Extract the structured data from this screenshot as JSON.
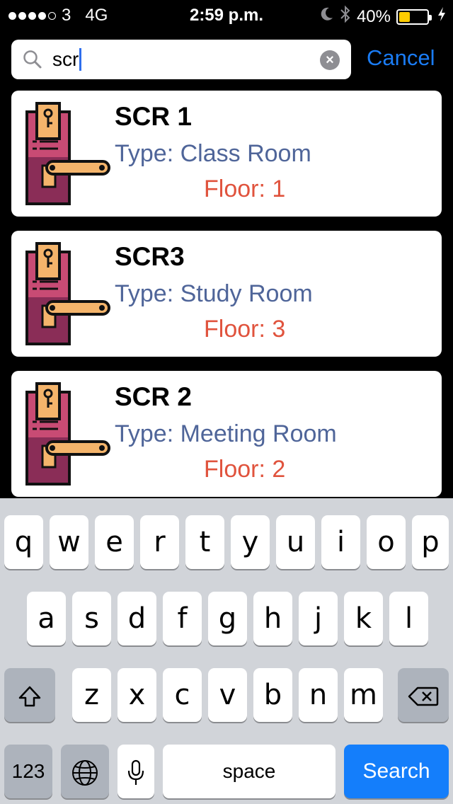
{
  "status_bar": {
    "carrier": "3",
    "network": "4G",
    "time": "2:59 p.m.",
    "battery": "40%",
    "battery_level": 0.4,
    "battery_color": "#ffcc00",
    "icons": [
      "signal-dots",
      "moon-icon",
      "bluetooth-icon",
      "battery-icon",
      "charging-bolt-icon"
    ]
  },
  "search": {
    "query": "scr",
    "cancel_label": "Cancel",
    "clear_icon": "clear-icon"
  },
  "results": [
    {
      "name": "SCR 1",
      "type": "Type: Class Room",
      "floor": "Floor: 1"
    },
    {
      "name": "SCR3",
      "type": "Type: Study Room",
      "floor": "Floor: 3"
    },
    {
      "name": "SCR 2",
      "type": "Type: Meeting Room",
      "floor": "Floor: 2"
    }
  ],
  "keyboard": {
    "row1": [
      "q",
      "w",
      "e",
      "r",
      "t",
      "y",
      "u",
      "i",
      "o",
      "p"
    ],
    "row2": [
      "a",
      "s",
      "d",
      "f",
      "g",
      "h",
      "j",
      "k",
      "l"
    ],
    "row3": [
      "z",
      "x",
      "c",
      "v",
      "b",
      "n",
      "m"
    ],
    "numbers_label": "123",
    "space_label": "space",
    "search_label": "Search"
  },
  "colors": {
    "accent": "#1a7cf5",
    "type_text": "#4f6599",
    "floor_text": "#e0533d"
  }
}
